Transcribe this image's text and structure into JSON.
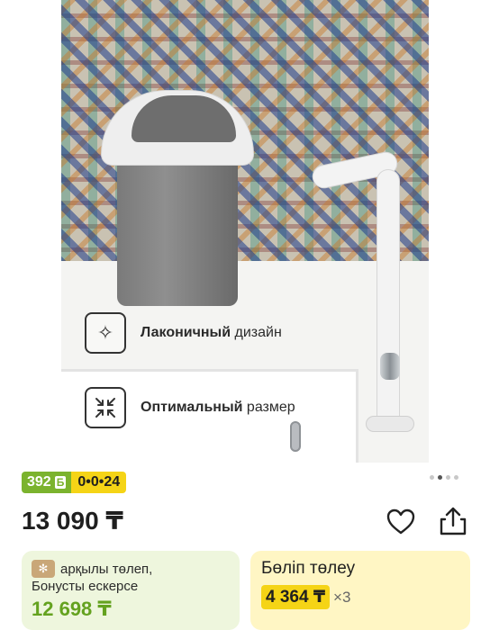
{
  "gallery": {
    "features": [
      {
        "icon": "sparkle-icon",
        "bold": "Лаконичный",
        "rest": " дизайн"
      },
      {
        "icon": "compress-arrows-icon",
        "bold": "Оптимальный",
        "rest": " размер"
      }
    ],
    "pager": {
      "count": 4,
      "active_index": 1
    }
  },
  "badges": {
    "score": "392",
    "score_unit": "Б",
    "installment": "0•0•24"
  },
  "price": "13 090 ₸",
  "actions": {
    "favorite_icon": "heart-icon",
    "share_icon": "share-icon"
  },
  "bonus_card": {
    "logo": "✻",
    "line1": "арқылы төлеп,",
    "line2": "Бонусты ескерсе",
    "value": "12 698 ₸"
  },
  "split_card": {
    "title": "Бөліп төлеу",
    "amount": "4 364 ₸",
    "times": "×3"
  },
  "colors": {
    "score_badge": "#7bb32e",
    "installment_badge": "#f5d416",
    "bonus_card_bg": "#eef6dd",
    "split_card_bg": "#fff6c4",
    "bonus_value": "#64a21f"
  }
}
